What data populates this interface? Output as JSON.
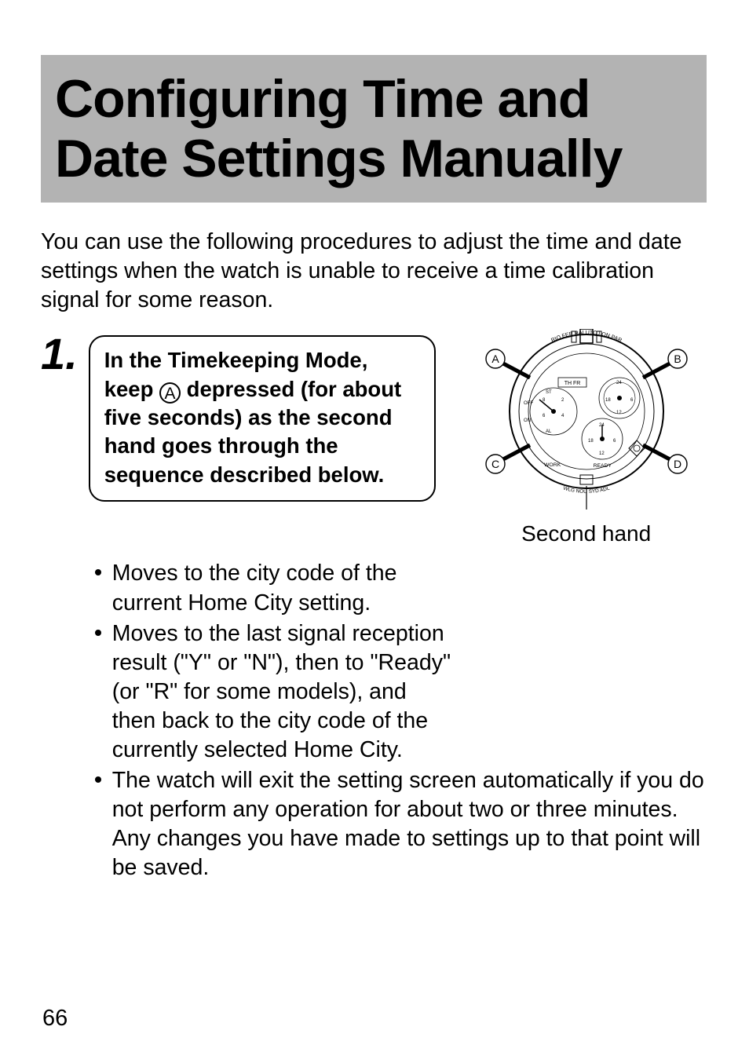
{
  "heading": "Configuring Time and Date Settings Manually",
  "intro": "You can use the following procedures to adjust the time and date settings when the watch is unable to receive a time calibration signal for some reason.",
  "step": {
    "number": "1.",
    "instruction_prefix": "In the Timekeeping Mode, keep ",
    "button_label": "A",
    "instruction_suffix": " depressed (for about five seconds) as the second hand goes through the sequence described below.",
    "bullets": [
      "Moves to the city code of the current Home City setting.",
      "Moves to the last signal reception result (\"Y\" or \"N\"), then to \"Ready\" (or \"R\" for some models), and then back to the city code of the currently selected Home City.",
      "The watch will exit the setting screen automatically if you do not perform any operation for about two or three minutes. Any changes you have made to settings up to that point will be saved."
    ]
  },
  "diagram": {
    "second_hand_label": "Second hand",
    "button_A": "A",
    "button_B": "B",
    "button_C": "C",
    "button_D": "D",
    "top_cities": "RIO   FER   RAI   UTC   LON   PAR",
    "bottom_left": "WORK",
    "bottom_right": "READY",
    "bottom_cities": "WLG   NOU   SYD   ADL",
    "days": "TH  FR",
    "st": "ST",
    "off": "OFF",
    "on": "ON",
    "al": "AL",
    "dial_labels": [
      "24",
      "18",
      "12",
      "6",
      "2",
      "4",
      "6",
      "8",
      "12",
      "18",
      "24",
      "6",
      "12"
    ]
  },
  "page_number": "66"
}
